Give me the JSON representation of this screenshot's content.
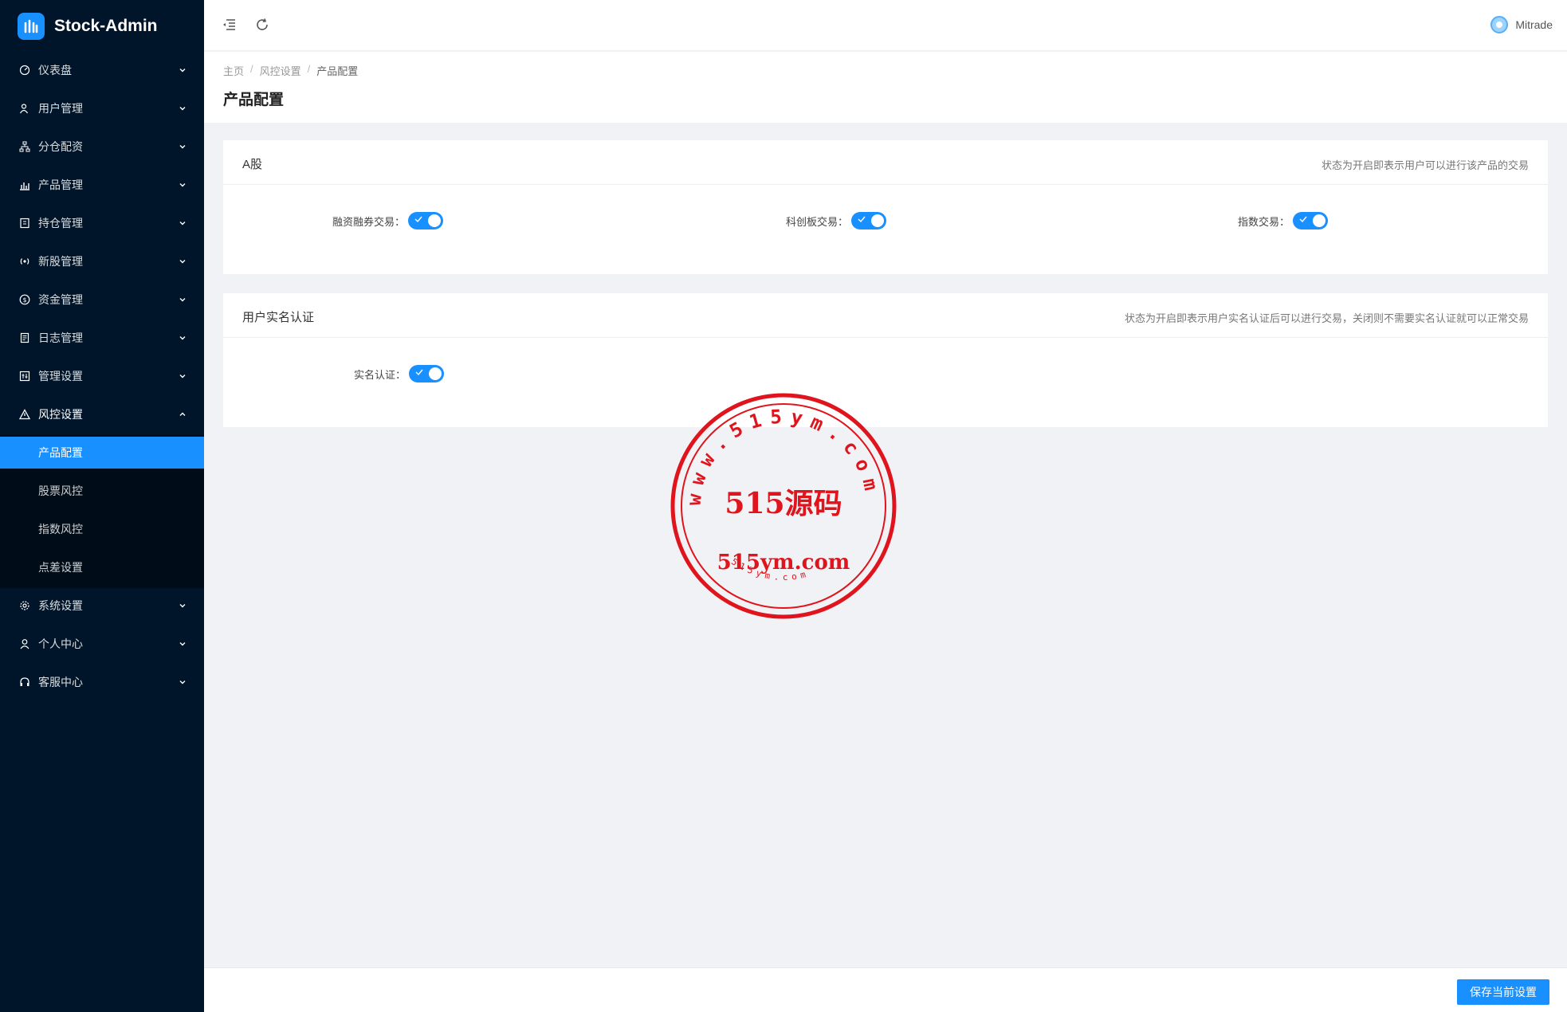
{
  "app": {
    "title": "Stock-Admin"
  },
  "sidebar": {
    "items": [
      {
        "label": "仪表盘",
        "icon": "dashboard-icon"
      },
      {
        "label": "用户管理",
        "icon": "users-icon"
      },
      {
        "label": "分仓配资",
        "icon": "sitemap-icon"
      },
      {
        "label": "产品管理",
        "icon": "bar-chart-icon"
      },
      {
        "label": "持仓管理",
        "icon": "holding-icon"
      },
      {
        "label": "新股管理",
        "icon": "broadcast-icon"
      },
      {
        "label": "资金管理",
        "icon": "dollar-icon"
      },
      {
        "label": "日志管理",
        "icon": "log-icon"
      },
      {
        "label": "管理设置",
        "icon": "admin-settings-icon"
      },
      {
        "label": "风控设置",
        "icon": "warning-icon"
      },
      {
        "label": "系统设置",
        "icon": "gear-icon"
      },
      {
        "label": "个人中心",
        "icon": "user-icon"
      },
      {
        "label": "客服中心",
        "icon": "headset-icon"
      }
    ],
    "submenu": [
      {
        "label": "产品配置",
        "active": true
      },
      {
        "label": "股票风控",
        "active": false
      },
      {
        "label": "指数风控",
        "active": false
      },
      {
        "label": "点差设置",
        "active": false
      }
    ]
  },
  "header": {
    "user": "Mitrade"
  },
  "breadcrumb": [
    "主页",
    "风控设置",
    "产品配置"
  ],
  "page": {
    "title": "产品配置"
  },
  "cards": {
    "a_share": {
      "title": "A股",
      "hint": "状态为开启即表示用户可以进行该产品的交易",
      "fields": [
        {
          "label": "融资融券交易：",
          "on": true
        },
        {
          "label": "科创板交易：",
          "on": true
        },
        {
          "label": "指数交易：",
          "on": true
        }
      ]
    },
    "realname": {
      "title": "用户实名认证",
      "hint": "状态为开启即表示用户实名认证后可以进行交易，关闭则不需要实名认证就可以正常交易",
      "fields": [
        {
          "label": "实名认证：",
          "on": true
        }
      ]
    }
  },
  "footer": {
    "save_label": "保存当前设置"
  },
  "watermark": {
    "center_text": "515源码",
    "url_text": "515ym.com",
    "ring_text": "www.515ym.com",
    "bottom_text": "515ym.com",
    "color": "#e0141d"
  },
  "colors": {
    "sidebar": "#001529",
    "accent": "#1890ff"
  }
}
